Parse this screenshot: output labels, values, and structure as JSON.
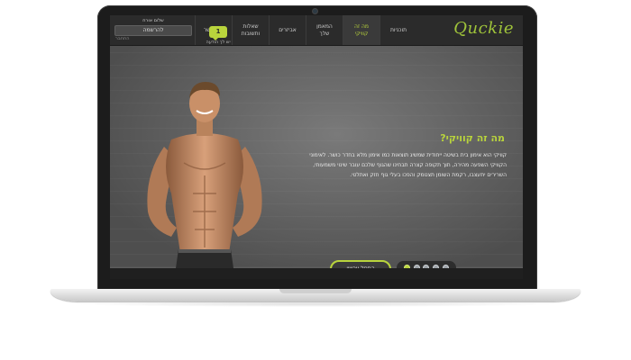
{
  "logo": "Quckie",
  "nav": {
    "items": [
      {
        "label": "תוכניות",
        "active": false
      },
      {
        "label": "מה זה\nקוויקי",
        "active": true
      },
      {
        "label": "המאמן\nשלך",
        "active": false
      },
      {
        "label": "אביזרים",
        "active": false
      },
      {
        "label": "שאלות\nותשובות",
        "active": false
      },
      {
        "label": "צרו קשר",
        "active": false
      }
    ]
  },
  "chat": {
    "count": "1",
    "label": "יש לך הודעה"
  },
  "user": {
    "greeting": "שלום אורח",
    "register_label": "להרשמה",
    "login_label": "התחבר"
  },
  "hero": {
    "title": "מה זה קוויקי?",
    "text": "קוויקי הוא אימון בית בשיטה ייחודית שמשיג תוצאות כמו אימון מלא בחדר כושר. לאימוני הקוויקי השפעה מהירה, תוך תקופה קצרה תבחינו שהגוף שלכם עובר שינוי משמעותי, השרירים יתעצבו, רקמת השומן תצטמק והפכו בעלי גוף חזק ואתלטי.",
    "cta_label": "התחל עכשיו",
    "slider": {
      "total": 5,
      "active_index": 0
    }
  },
  "colors": {
    "accent": "#b9d43c",
    "nav_bg": "#2b2b2b",
    "hero_bg": "#5c5c5c"
  }
}
